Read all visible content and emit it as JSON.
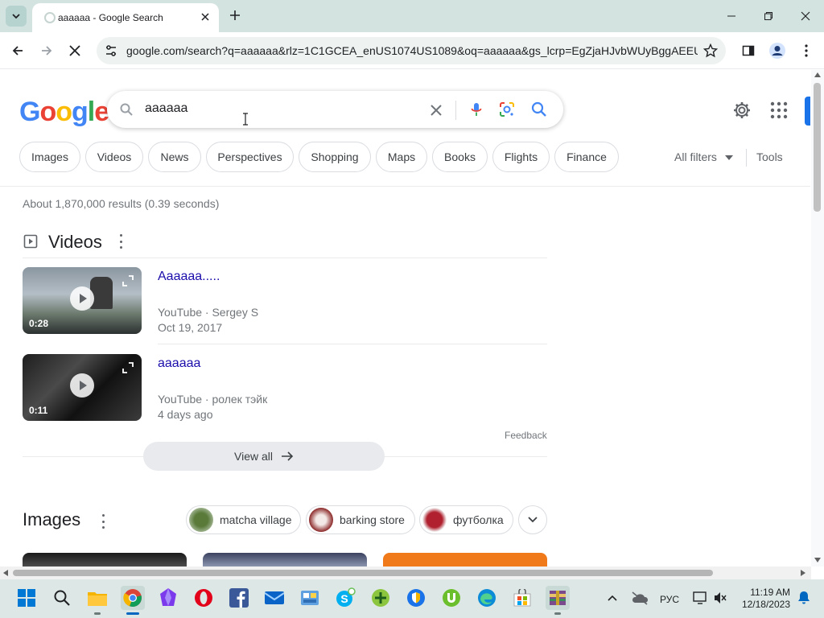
{
  "browser": {
    "tab_title": "aaaaaa - Google Search",
    "url": "google.com/search?q=aaaaaa&rlz=1C1GCEA_enUS1074US1089&oq=aaaaaa&gs_lcrp=EgZjaHJvbWUyBggAEEUY..."
  },
  "search": {
    "query": "aaaaaa",
    "logo": "Google"
  },
  "chips": [
    "Images",
    "Videos",
    "News",
    "Perspectives",
    "Shopping",
    "Maps",
    "Books",
    "Flights",
    "Finance"
  ],
  "filters": {
    "all_filters": "All filters",
    "tools": "Tools"
  },
  "result_stats": "About 1,870,000 results (0.39 seconds)",
  "videos": {
    "heading": "Videos",
    "items": [
      {
        "title": "Aaaaaa.....",
        "source": "YouTube · Sergey S",
        "date": "Oct 19, 2017",
        "duration": "0:28"
      },
      {
        "title": "aaaaaa",
        "source": "YouTube · ролек тэйк",
        "date": "4 days ago",
        "duration": "0:11"
      }
    ],
    "feedback": "Feedback",
    "view_all": "View all"
  },
  "images": {
    "heading": "Images",
    "chips": [
      "matcha village",
      "barking store",
      "футболка"
    ]
  },
  "taskbar": {
    "lang": "РУС",
    "time": "11:19 AM",
    "date": "12/18/2023"
  },
  "colors": {
    "link": "#1a0dab",
    "accent": "#1a73e8",
    "tab_strip": "#d3e3e0"
  }
}
